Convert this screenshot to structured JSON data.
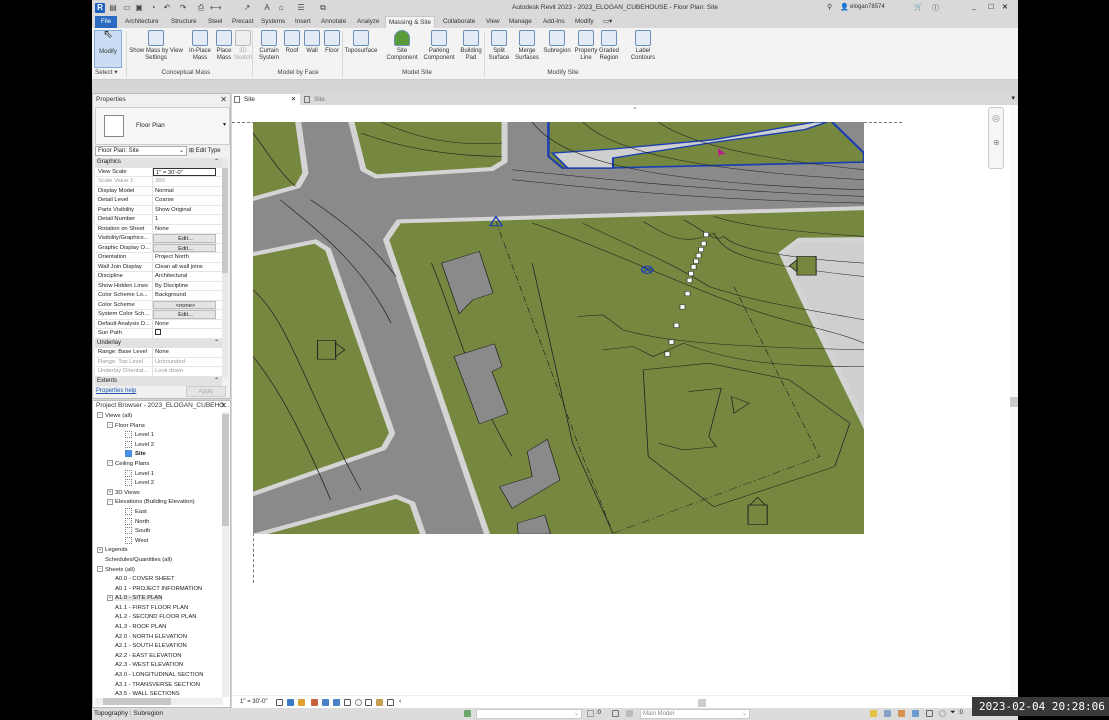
{
  "window": {
    "title": "Autodesk Revit 2023 - 2023_ELOGAN_CUBEHOUSE - Floor Plan: Site",
    "user": "elogan78574"
  },
  "ribbon_tabs": [
    "File",
    "Architecture",
    "Structure",
    "Steel",
    "Precast",
    "Systems",
    "Insert",
    "Annotate",
    "Analyze",
    "Massing & Site",
    "Collaborate",
    "View",
    "Manage",
    "Add-Ins",
    "Modify"
  ],
  "active_tab": "Massing & Site",
  "ribbon_buttons": [
    {
      "label": "Modify",
      "icon": "cursor-icon"
    },
    {
      "label": "Show Mass by View Settings",
      "icon": "show-mass-icon"
    },
    {
      "label": "In-Place Mass",
      "icon": "in-place-mass-icon"
    },
    {
      "label": "Place Mass",
      "icon": "place-mass-icon"
    },
    {
      "label": "3D Sketch",
      "icon": "3d-sketch-icon",
      "disabled": true
    },
    {
      "label": "Curtain System",
      "icon": "curtain-system-icon"
    },
    {
      "label": "Roof",
      "icon": "roof-icon"
    },
    {
      "label": "Wall",
      "icon": "wall-icon"
    },
    {
      "label": "Floor",
      "icon": "floor-icon"
    },
    {
      "label": "Toposurface",
      "icon": "toposurface-icon"
    },
    {
      "label": "Site Component",
      "icon": "tree-icon"
    },
    {
      "label": "Parking Component",
      "icon": "parking-icon"
    },
    {
      "label": "Building Pad",
      "icon": "building-pad-icon"
    },
    {
      "label": "Split Surface",
      "icon": "split-surface-icon"
    },
    {
      "label": "Merge Surfaces",
      "icon": "merge-surfaces-icon"
    },
    {
      "label": "Subregion",
      "icon": "subregion-icon"
    },
    {
      "label": "Property Line",
      "icon": "property-line-icon"
    },
    {
      "label": "Graded Region",
      "icon": "graded-region-icon"
    },
    {
      "label": "Label Contours",
      "icon": "label-contours-icon"
    }
  ],
  "ribbon_panels": [
    "Select",
    "Conceptual Mass",
    "Model by Face",
    "Model Site",
    "Modify Site"
  ],
  "properties": {
    "title": "Properties",
    "type_name": "Floor Plan",
    "instance": "Floor Plan: Site",
    "edit_type": "Edit Type",
    "sections": [
      {
        "name": "Graphics",
        "rows": [
          [
            "View Scale",
            "1\" = 30'-0\"",
            "box"
          ],
          [
            "Scale Value    1:",
            "360",
            "dim"
          ],
          [
            "Display Model",
            "Normal"
          ],
          [
            "Detail Level",
            "Coarse"
          ],
          [
            "Parts Visibility",
            "Show Original"
          ],
          [
            "Detail Number",
            "1"
          ],
          [
            "Rotation on Sheet",
            "None"
          ],
          [
            "Visibility/Graphics...",
            "Edit...",
            "btn"
          ],
          [
            "Graphic Display O...",
            "Edit...",
            "btn"
          ],
          [
            "Orientation",
            "Project North"
          ],
          [
            "Wall Join Display",
            "Clean all wall joins"
          ],
          [
            "Discipline",
            "Architectural"
          ],
          [
            "Show Hidden Lines",
            "By Discipline"
          ],
          [
            "Color Scheme Lo...",
            "Background"
          ],
          [
            "Color Scheme",
            "<none>",
            "btn"
          ],
          [
            "System Color Sch...",
            "Edit...",
            "btn"
          ],
          [
            "Default Analysis D...",
            "None"
          ],
          [
            "Sun Path",
            "",
            "check"
          ]
        ]
      },
      {
        "name": "Underlay",
        "rows": [
          [
            "Range: Base Level",
            "None"
          ],
          [
            "Range: Top Level",
            "Unbounded",
            "dim"
          ],
          [
            "Underlay Orientat...",
            "Look down",
            "dim"
          ]
        ]
      },
      {
        "name": "Extents",
        "rows": []
      }
    ],
    "help": "Properties help",
    "apply": "Apply"
  },
  "browser": {
    "title": "Project Browser - 2023_ELOGAN_CUBEHO...",
    "items": [
      {
        "label": "Views (all)",
        "level": 0,
        "exp": "-"
      },
      {
        "label": "Floor Plans",
        "level": 1,
        "exp": "-"
      },
      {
        "label": "Level 1",
        "level": 2,
        "view": true
      },
      {
        "label": "Level 2",
        "level": 2,
        "view": true
      },
      {
        "label": "Site",
        "level": 2,
        "view": true,
        "bold": true
      },
      {
        "label": "Ceiling Plans",
        "level": 1,
        "exp": "-"
      },
      {
        "label": "Level 1",
        "level": 2,
        "view": true
      },
      {
        "label": "Level 2",
        "level": 2,
        "view": true
      },
      {
        "label": "3D Views",
        "level": 1,
        "exp": "+"
      },
      {
        "label": "Elevations (Building Elevation)",
        "level": 1,
        "exp": "-"
      },
      {
        "label": "East",
        "level": 2,
        "view": true
      },
      {
        "label": "North",
        "level": 2,
        "view": true
      },
      {
        "label": "South",
        "level": 2,
        "view": true
      },
      {
        "label": "West",
        "level": 2,
        "view": true
      },
      {
        "label": "Legends",
        "level": 0,
        "exp": "+"
      },
      {
        "label": "Schedules/Quantities (all)",
        "level": 0
      },
      {
        "label": "Sheets (all)",
        "level": 0,
        "exp": "-"
      },
      {
        "label": "A0.0 - COVER SHEET",
        "level": 1
      },
      {
        "label": "A0.1 - PROJECT INFORMATION",
        "level": 1
      },
      {
        "label": "A1.0 - SITE PLAN",
        "level": 1,
        "exp": "+",
        "hl": true
      },
      {
        "label": "A1.1 - FIRST FLOOR PLAN",
        "level": 1
      },
      {
        "label": "A1.2 - SECOND FLOOR PLAN",
        "level": 1
      },
      {
        "label": "A1.3 - ROOF PLAN",
        "level": 1
      },
      {
        "label": "A2.0 - NORTH ELEVATION",
        "level": 1
      },
      {
        "label": "A2.1 - SOUTH ELEVATION",
        "level": 1
      },
      {
        "label": "A2.2 - EAST ELEVATION",
        "level": 1
      },
      {
        "label": "A2.3 - WEST ELEVATION",
        "level": 1
      },
      {
        "label": "A3.0 - LONGITUDINAL SECTION",
        "level": 1
      },
      {
        "label": "A3.1 - TRANSVERSE SECTION",
        "level": 1
      },
      {
        "label": "A3.5 - WALL SECTIONS",
        "level": 1
      }
    ]
  },
  "view_tabs": [
    "Site",
    "Site"
  ],
  "view_bar": {
    "scale": "1\" = 30'-0\""
  },
  "status": {
    "text": "Topography : Subregion",
    "workset_value": ":0",
    "model": "Main Model",
    "filter_count": ":0"
  },
  "timestamp": "2023-02-04 20:28:06",
  "colors": {
    "terrain": "#76883f",
    "road": "#8a8a8a",
    "curb": "#d4d4d4",
    "boundary": "#1a3fb0",
    "accent": "#2a6bc1"
  }
}
